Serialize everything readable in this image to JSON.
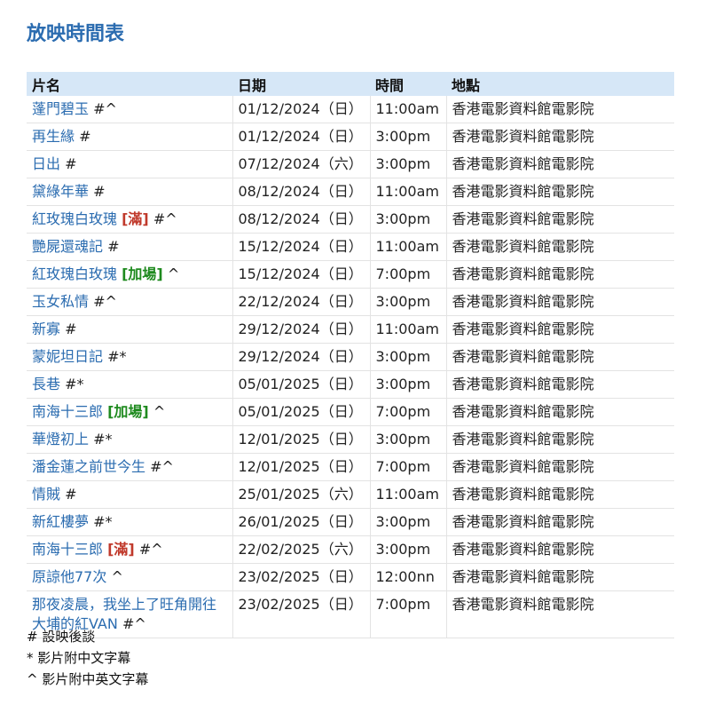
{
  "page": {
    "title": "放映時間表"
  },
  "table": {
    "headers": {
      "title": "片名",
      "date": "日期",
      "time": "時間",
      "venue": "地點"
    },
    "rows": [
      {
        "title": "蓬門碧玉",
        "tag": "",
        "tag_type": "",
        "symbols": "#^",
        "date": "01/12/2024（日）",
        "time": "11:00am",
        "venue": "香港電影資料館電影院"
      },
      {
        "title": "再生緣",
        "tag": "",
        "tag_type": "",
        "symbols": "#",
        "date": "01/12/2024（日）",
        "time": "3:00pm",
        "venue": "香港電影資料館電影院"
      },
      {
        "title": "日出",
        "tag": "",
        "tag_type": "",
        "symbols": "#",
        "date": "07/12/2024（六）",
        "time": "3:00pm",
        "venue": "香港電影資料館電影院"
      },
      {
        "title": "黛綠年華",
        "tag": "",
        "tag_type": "",
        "symbols": "#",
        "date": "08/12/2024（日）",
        "time": "11:00am",
        "venue": "香港電影資料館電影院"
      },
      {
        "title": "紅玫瑰白玫瑰",
        "tag": "[滿]",
        "tag_type": "full",
        "symbols": "#^",
        "date": "08/12/2024（日）",
        "time": "3:00pm",
        "venue": "香港電影資料館電影院"
      },
      {
        "title": "艷屍還魂記",
        "tag": "",
        "tag_type": "",
        "symbols": "#",
        "date": "15/12/2024（日）",
        "time": "11:00am",
        "venue": "香港電影資料館電影院"
      },
      {
        "title": "紅玫瑰白玫瑰",
        "tag": "[加場]",
        "tag_type": "extra",
        "symbols": "^",
        "date": "15/12/2024（日）",
        "time": "7:00pm",
        "venue": "香港電影資料館電影院"
      },
      {
        "title": "玉女私情",
        "tag": "",
        "tag_type": "",
        "symbols": "#^",
        "date": "22/12/2024（日）",
        "time": "3:00pm",
        "venue": "香港電影資料館電影院"
      },
      {
        "title": "新寡",
        "tag": "",
        "tag_type": "",
        "symbols": "#",
        "date": "29/12/2024（日）",
        "time": "11:00am",
        "venue": "香港電影資料館電影院"
      },
      {
        "title": "蒙妮坦日記",
        "tag": "",
        "tag_type": "",
        "symbols": "#*",
        "date": "29/12/2024（日）",
        "time": "3:00pm",
        "venue": "香港電影資料館電影院"
      },
      {
        "title": "長巷",
        "tag": "",
        "tag_type": "",
        "symbols": "#*",
        "date": "05/01/2025（日）",
        "time": "3:00pm",
        "venue": "香港電影資料館電影院"
      },
      {
        "title": "南海十三郎",
        "tag": "[加場]",
        "tag_type": "extra",
        "symbols": "^",
        "date": "05/01/2025（日）",
        "time": "7:00pm",
        "venue": "香港電影資料館電影院"
      },
      {
        "title": "華燈初上",
        "tag": "",
        "tag_type": "",
        "symbols": "#*",
        "date": "12/01/2025（日）",
        "time": "3:00pm",
        "venue": "香港電影資料館電影院"
      },
      {
        "title": "潘金蓮之前世今生",
        "tag": "",
        "tag_type": "",
        "symbols": "#^",
        "date": "12/01/2025（日）",
        "time": "7:00pm",
        "venue": "香港電影資料館電影院"
      },
      {
        "title": "情賊",
        "tag": "",
        "tag_type": "",
        "symbols": "#",
        "date": "25/01/2025（六）",
        "time": "11:00am",
        "venue": "香港電影資料館電影院"
      },
      {
        "title": "新紅樓夢",
        "tag": "",
        "tag_type": "",
        "symbols": "#*",
        "date": "26/01/2025（日）",
        "time": "3:00pm",
        "venue": "香港電影資料館電影院"
      },
      {
        "title": "南海十三郎",
        "tag": "[滿]",
        "tag_type": "full",
        "symbols": "#^",
        "date": "22/02/2025（六）",
        "time": "3:00pm",
        "venue": "香港電影資料館電影院"
      },
      {
        "title": "原諒他77次",
        "tag": "",
        "tag_type": "",
        "symbols": "^",
        "date": "23/02/2025（日）",
        "time": "12:00nn",
        "venue": "香港電影資料館電影院"
      },
      {
        "title": "那夜凌晨，我坐上了旺角開往大埔的紅VAN",
        "tag": "",
        "tag_type": "",
        "symbols": "#^",
        "date": "23/02/2025（日）",
        "time": "7:00pm",
        "venue": "香港電影資料館電影院"
      }
    ]
  },
  "notes": [
    "# 設映後談",
    "* 影片附中文字幕",
    "^ 影片附中英文字幕"
  ],
  "colors": {
    "title": "#2b6cb0",
    "film_link": "#2b6cb0",
    "header_bg": "#d6e7f7",
    "tag_full": "#c0392b",
    "tag_extra": "#1e8a1e"
  }
}
